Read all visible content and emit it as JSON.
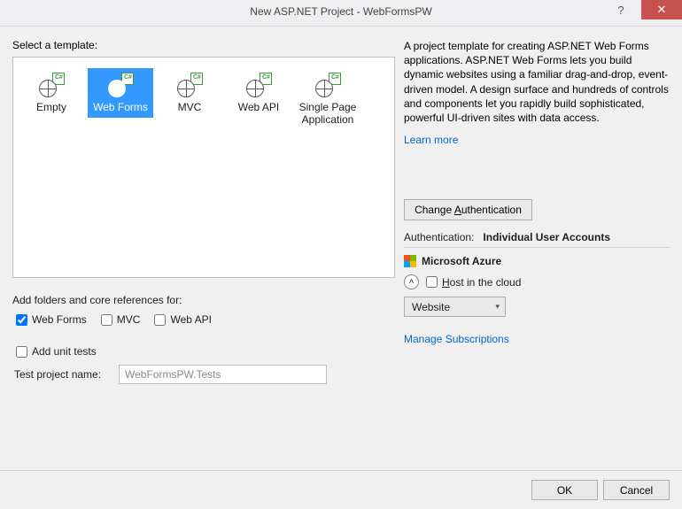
{
  "titlebar": {
    "title": "New ASP.NET Project - WebFormsPW"
  },
  "left": {
    "select_template": "Select a template:",
    "templates": [
      {
        "label": "Empty",
        "selected": false
      },
      {
        "label": "Web Forms",
        "selected": true
      },
      {
        "label": "MVC",
        "selected": false
      },
      {
        "label": "Web API",
        "selected": false
      },
      {
        "label": "Single Page Application",
        "selected": false
      }
    ],
    "folders_label": "Add folders and core references for:",
    "checks": {
      "webforms": {
        "label": "Web Forms",
        "checked": true
      },
      "mvc": {
        "label": "MVC",
        "checked": false
      },
      "webapi": {
        "label": "Web API",
        "checked": false
      }
    },
    "unit_tests": {
      "label": "Add unit tests",
      "checked": false
    },
    "test_project_label": "Test project name:",
    "test_project_value": "WebFormsPW.Tests"
  },
  "right": {
    "description": "A project template for creating ASP.NET Web Forms applications. ASP.NET Web Forms lets you build dynamic websites using a familiar drag-and-drop, event-driven model. A design surface and hundreds of controls and components let you rapidly build sophisticated, powerful UI-driven sites with data access.",
    "learn_more": "Learn more",
    "change_auth": "Change Authentication",
    "auth_label": "Authentication:",
    "auth_value": "Individual User Accounts",
    "azure_title": "Microsoft Azure",
    "host_label": "Host in the cloud",
    "host_checked": false,
    "dropdown_value": "Website",
    "manage_subs": "Manage Subscriptions"
  },
  "footer": {
    "ok": "OK",
    "cancel": "Cancel"
  }
}
